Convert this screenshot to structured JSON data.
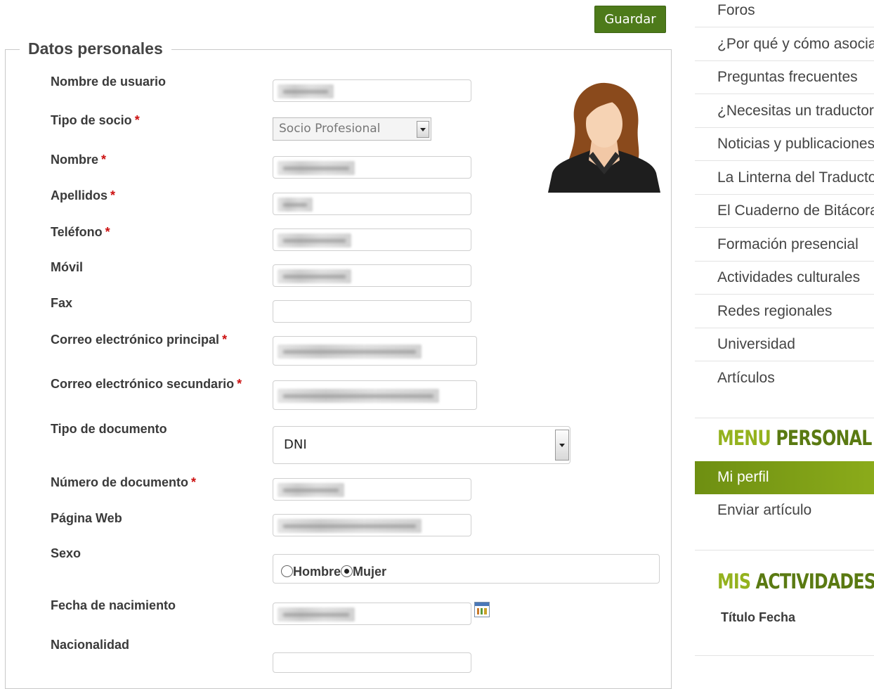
{
  "toolbar": {
    "save_label": "Guardar"
  },
  "form": {
    "legend": "Datos personales",
    "required_mark": "*",
    "fields": {
      "username": {
        "label": "Nombre de usuario"
      },
      "member_type": {
        "label": "Tipo de socio",
        "value": "Socio Profesional"
      },
      "first_name": {
        "label": "Nombre"
      },
      "last_name": {
        "label": "Apellidos"
      },
      "phone": {
        "label": "Teléfono"
      },
      "mobile": {
        "label": "Móvil"
      },
      "fax": {
        "label": "Fax"
      },
      "email_primary": {
        "label": "Correo electrónico principal"
      },
      "email_secondary": {
        "label": "Correo electrónico secundario"
      },
      "doc_type": {
        "label": "Tipo de documento",
        "value": "DNI"
      },
      "doc_number": {
        "label": "Número de documento"
      },
      "website": {
        "label": "Página Web"
      },
      "sex": {
        "label": "Sexo",
        "options": [
          "Hombre",
          "Mujer"
        ],
        "selected": "Mujer"
      },
      "birth_date": {
        "label": "Fecha de nacimiento"
      },
      "nationality": {
        "label": "Nacionalidad"
      }
    }
  },
  "sidebar": {
    "nav": [
      "Foros",
      "¿Por qué y cómo asociarse?",
      "Preguntas frecuentes",
      "¿Necesitas un traductor?",
      "Noticias y publicaciones",
      "La Linterna del Traductor",
      "El Cuaderno de Bitácora",
      "Formación presencial",
      "Actividades culturales",
      "Redes regionales",
      "Universidad",
      "Artículos"
    ],
    "personal_menu": {
      "heading_a": "MENU",
      "heading_b": "PERSONAL",
      "items": [
        "Mi perfil",
        "Enviar artículo"
      ],
      "active": "Mi perfil"
    },
    "activities": {
      "heading_a": "MIS",
      "heading_b": "ACTIVIDADES",
      "col_title": "Título",
      "col_date": "Fecha"
    }
  },
  "colors": {
    "save_button": "#4d7a1a",
    "heading_light": "#94b21e",
    "heading_dark": "#5a7a12",
    "active_item": "#7a9b14",
    "required": "#cc1111"
  }
}
